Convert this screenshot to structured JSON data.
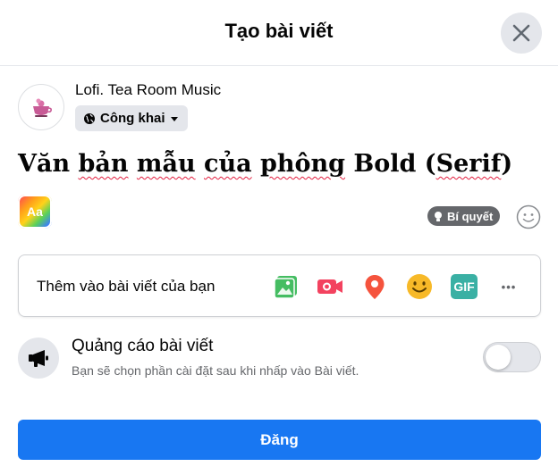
{
  "dialog": {
    "title": "Tạo bài viết"
  },
  "user": {
    "name": "Lofi. Tea Room Music",
    "privacy": "Công khai"
  },
  "composer": {
    "text_parts": [
      "Văn ",
      "bản",
      " ",
      "mẫu",
      " ",
      "của",
      " ",
      "phông",
      " Bold (",
      "Serif",
      ")"
    ],
    "background_picker_label": "Aa",
    "tips_label": "Bí quyết"
  },
  "add_to_post": {
    "label": "Thêm vào bài viết của bạn",
    "icons": [
      "photo-video-icon",
      "live-video-icon",
      "location-pin-icon",
      "feeling-icon",
      "gif-icon",
      "more-icon"
    ],
    "gif_text": "GIF",
    "more_text": "•••"
  },
  "ad": {
    "title": "Quảng cáo bài viết",
    "description": "Bạn sẽ chọn phần cài đặt sau khi nhấp vào Bài viết.",
    "enabled": false
  },
  "actions": {
    "post_label": "Đăng"
  },
  "colors": {
    "primary": "#1877f2",
    "photo_green": "#45bd62",
    "video_red": "#f3425f",
    "location_red": "#f5533d",
    "feeling_yellow": "#f7b928",
    "gif_teal": "#3ab0a4"
  }
}
